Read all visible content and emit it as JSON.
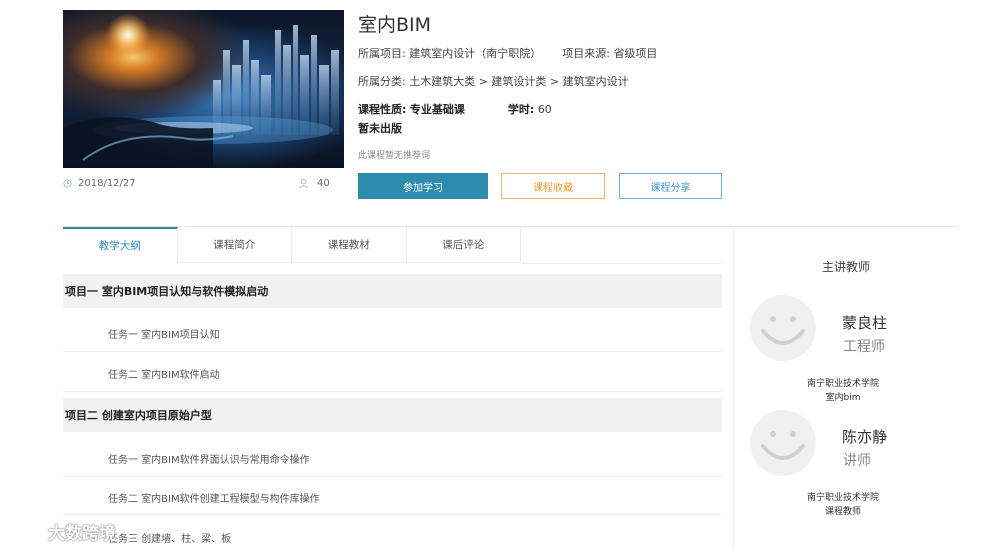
{
  "course": {
    "title": "室内BIM",
    "project_label": "所属项目:",
    "project_value": "建筑室内设计（南宁职院）",
    "source_label": "项目来源:",
    "source_value": "省级项目",
    "category_label": "所属分类:",
    "category_value": "土木建筑大类 > 建筑设计类 > 建筑室内设计",
    "nature_label": "课程性质:",
    "nature_value": "专业基础课",
    "hours_label": "学时:",
    "hours_value": "60",
    "publish_status": "暂未出版",
    "note": "此课程暂无推荐词",
    "date": "2018/12/27",
    "views": "40"
  },
  "buttons": {
    "join": "参加学习",
    "favorite": "课程收藏",
    "share": "课程分享"
  },
  "tabs": [
    {
      "label": "教学大纲",
      "active": true
    },
    {
      "label": "课程简介",
      "active": false
    },
    {
      "label": "课程教材",
      "active": false
    },
    {
      "label": "课后评论",
      "active": false
    }
  ],
  "syllabus": {
    "project1": "项目一 室内BIM项目认知与软件模拟启动",
    "project1_tasks": [
      "任务一 室内BIM项目认知",
      "任务二 室内BIM软件启动"
    ],
    "project2": "项目二 创建室内项目原始户型",
    "project2_tasks": [
      "任务一 室内BIM软件界面认识与常用命令操作",
      "任务二 室内BIM软件创建工程模型与构件库操作",
      "任务三 创建墙、柱、梁、板"
    ]
  },
  "teachers": {
    "heading": "主讲教师",
    "list": [
      {
        "name": "蒙良柱",
        "title": "工程师",
        "org_line1": "南宁职业技术学院",
        "org_line2": "室内bim"
      },
      {
        "name": "陈亦静",
        "title": "讲师",
        "org_line1": "南宁职业技术学院",
        "org_line2": "课程教师"
      }
    ]
  },
  "watermark": "大数跨境",
  "colors": {
    "primary": "#2d8cad",
    "favorite": "#e79c33",
    "share": "#3a9bd0"
  }
}
